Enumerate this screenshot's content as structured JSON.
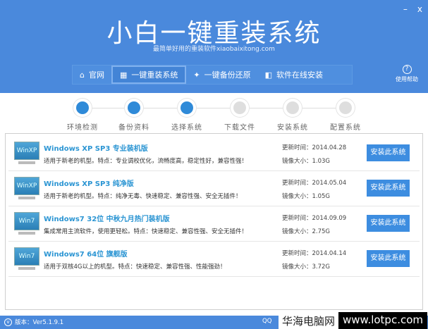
{
  "window": {
    "minimize": "–",
    "close": "x"
  },
  "header": {
    "title": "小白一键重装系统",
    "subtitle": "最简单好用的重装软件xiaobaixitong.com"
  },
  "nav": [
    {
      "icon": "home-icon",
      "label": "官网"
    },
    {
      "icon": "windows-icon",
      "label": "一键重装系统",
      "active": true
    },
    {
      "icon": "bird-icon",
      "label": "一键备份还原"
    },
    {
      "icon": "apps-icon",
      "label": "软件在线安装"
    }
  ],
  "help": {
    "label": "使用帮助"
  },
  "steps": [
    {
      "label": "环境检测",
      "done": true
    },
    {
      "label": "备份资料",
      "done": true
    },
    {
      "label": "选择系统",
      "done": true
    },
    {
      "label": "下载文件",
      "done": false
    },
    {
      "label": "安装系统",
      "done": false
    },
    {
      "label": "配置系统",
      "done": false
    }
  ],
  "systems": [
    {
      "badge": "WinXP",
      "name": "Windows XP SP3 专业装机版",
      "desc": "适用于新老的机型。特点：专业调校优化，流畅度高，稳定性好，兼容性强！",
      "updated": "更新时间：2014.04.28",
      "size": "镜像大小：1.03G",
      "button": "安装此系统"
    },
    {
      "badge": "WinXP",
      "name": "Windows XP SP3 纯净版",
      "desc": "适用于新老的机型。特点：纯净无毒、快速稳定、兼容性强、安全无插件！",
      "updated": "更新时间：2014.05.04",
      "size": "镜像大小：1.05G",
      "button": "安装此系统"
    },
    {
      "badge": "Win7",
      "name": "Windows7 32位 中秋九月热门装机版",
      "desc": "集成常用主流软件，使用更轻松。特点：快速稳定、兼容性强、安全无插件！",
      "updated": "更新时间：2014.09.09",
      "size": "镜像大小：2.75G",
      "button": "安装此系统"
    },
    {
      "badge": "Win7",
      "name": "Windows7 64位 旗舰版",
      "desc": "适用于双核4G以上的机型。特点：快速稳定、兼容性强、性能强劲！",
      "updated": "更新时间：2014.04.14",
      "size": "镜像大小：3.72G",
      "button": "安装此系统"
    }
  ],
  "footer": {
    "version": "版本：Ver5.1.9.1",
    "qq": "QQ"
  },
  "watermark": {
    "text1": "华海电脑网",
    "text2": "www.lotpc.com"
  }
}
